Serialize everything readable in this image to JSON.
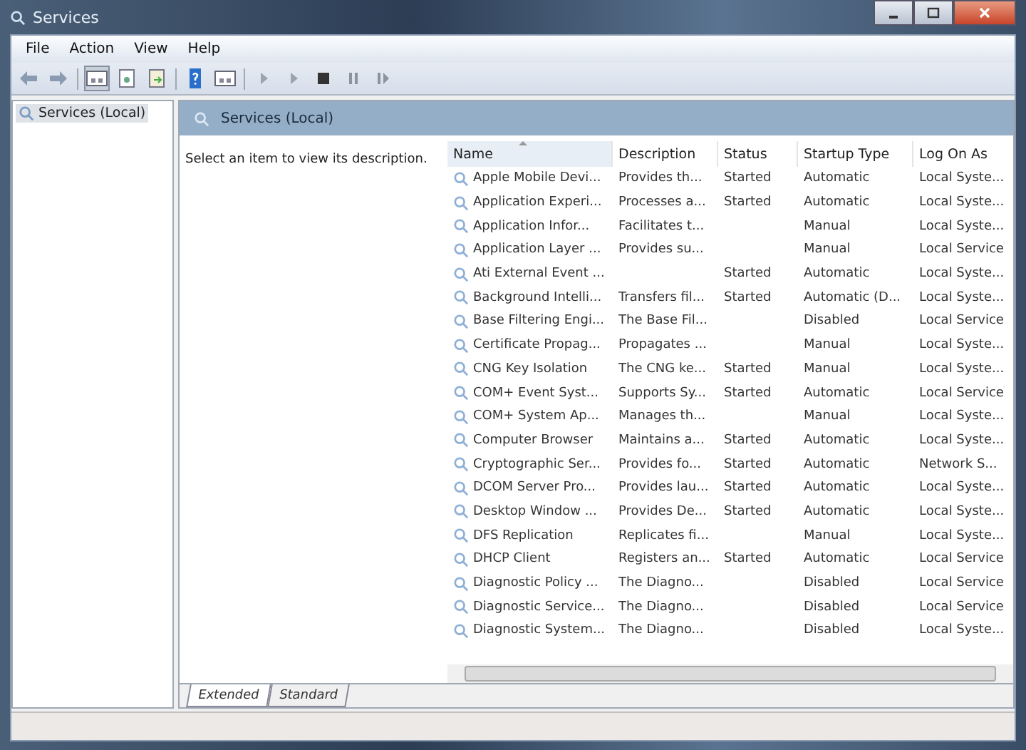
{
  "window": {
    "title": "Services"
  },
  "menu": [
    "File",
    "Action",
    "View",
    "Help"
  ],
  "tree": {
    "items": [
      {
        "label": "Services (Local)",
        "selected": true
      }
    ]
  },
  "panel": {
    "title": "Services (Local)",
    "description": "Select an item to view its description."
  },
  "table": {
    "columns": [
      "Name",
      "Description",
      "Status",
      "Startup Type",
      "Log On As"
    ],
    "rows": [
      [
        "Apple Mobile Devi...",
        "Provides th...",
        "Started",
        "Automatic",
        "Local Syste..."
      ],
      [
        "Application Experi...",
        "Processes a...",
        "Started",
        "Automatic",
        "Local Syste..."
      ],
      [
        "Application Infor...",
        "Facilitates t...",
        "",
        "Manual",
        "Local Syste..."
      ],
      [
        "Application Layer ...",
        "Provides su...",
        "",
        "Manual",
        "Local Service"
      ],
      [
        "Ati External Event ...",
        "",
        "Started",
        "Automatic",
        "Local Syste..."
      ],
      [
        "Background Intelli...",
        "Transfers fil...",
        "Started",
        "Automatic (D...",
        "Local Syste..."
      ],
      [
        "Base Filtering Engi...",
        "The Base Fil...",
        "",
        "Disabled",
        "Local Service"
      ],
      [
        "Certificate Propag...",
        "Propagates ...",
        "",
        "Manual",
        "Local Syste..."
      ],
      [
        "CNG Key Isolation",
        "The CNG ke...",
        "Started",
        "Manual",
        "Local Syste..."
      ],
      [
        "COM+ Event Syst...",
        "Supports Sy...",
        "Started",
        "Automatic",
        "Local Service"
      ],
      [
        "COM+ System Ap...",
        "Manages th...",
        "",
        "Manual",
        "Local Syste..."
      ],
      [
        "Computer Browser",
        "Maintains a...",
        "Started",
        "Automatic",
        "Local Syste..."
      ],
      [
        "Cryptographic Ser...",
        "Provides fo...",
        "Started",
        "Automatic",
        "Network S..."
      ],
      [
        "DCOM Server Pro...",
        "Provides lau...",
        "Started",
        "Automatic",
        "Local Syste..."
      ],
      [
        "Desktop Window ...",
        "Provides De...",
        "Started",
        "Automatic",
        "Local Syste..."
      ],
      [
        "DFS Replication",
        "Replicates fi...",
        "",
        "Manual",
        "Local Syste..."
      ],
      [
        "DHCP Client",
        "Registers an...",
        "Started",
        "Automatic",
        "Local Service"
      ],
      [
        "Diagnostic Policy ...",
        "The Diagno...",
        "",
        "Disabled",
        "Local Service"
      ],
      [
        "Diagnostic Service...",
        "The Diagno...",
        "",
        "Disabled",
        "Local Service"
      ],
      [
        "Diagnostic System...",
        "The Diagno...",
        "",
        "Disabled",
        "Local Syste..."
      ]
    ]
  },
  "tabs": [
    {
      "label": "Extended",
      "selected": true
    },
    {
      "label": "Standard",
      "selected": false
    }
  ]
}
